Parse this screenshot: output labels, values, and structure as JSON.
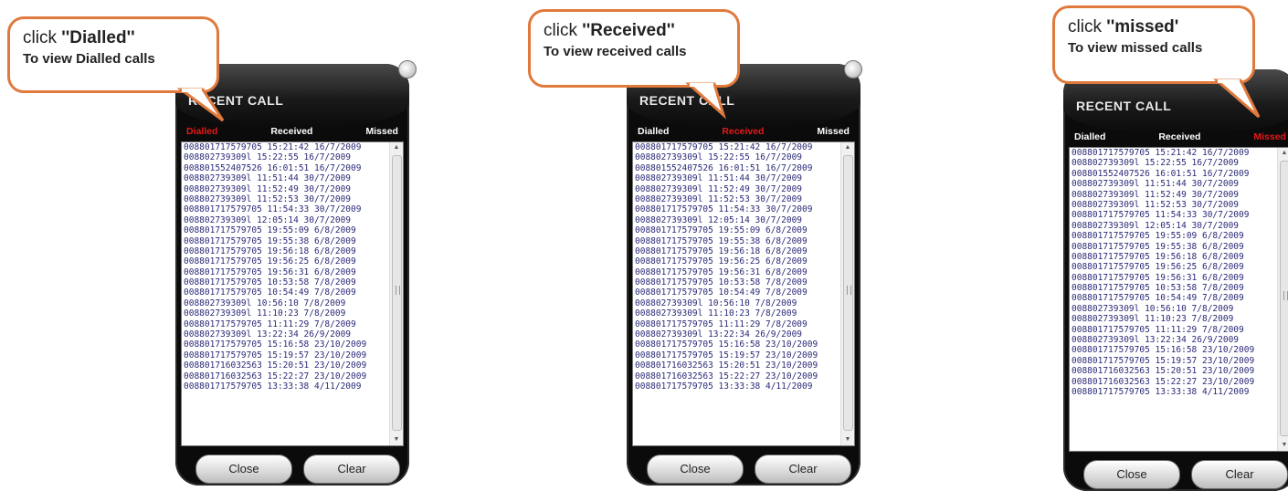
{
  "screen": {
    "title": "RECENT CALL",
    "tabs": [
      "Dialled",
      "Received",
      "Missed"
    ],
    "calls": [
      "008801717579705  15:21:42  16/7/2009",
      "008802739309l  15:22:55  16/7/2009",
      "008801552407526  16:01:51  16/7/2009",
      "008802739309l  11:51:44  30/7/2009",
      "008802739309l  11:52:49  30/7/2009",
      "008802739309l  11:52:53  30/7/2009",
      "008801717579705  11:54:33  30/7/2009",
      "008802739309l  12:05:14  30/7/2009",
      "008801717579705  19:55:09  6/8/2009",
      "008801717579705  19:55:38  6/8/2009",
      "008801717579705  19:56:18  6/8/2009",
      "008801717579705  19:56:25  6/8/2009",
      "008801717579705  19:56:31  6/8/2009",
      "008801717579705  10:53:58  7/8/2009",
      "008801717579705  10:54:49  7/8/2009",
      "008802739309l  10:56:10  7/8/2009",
      "008802739309l  11:10:23  7/8/2009",
      "008801717579705  11:11:29  7/8/2009",
      "008802739309l  13:22:34  26/9/2009",
      "008801717579705  15:16:58  23/10/2009",
      "008801717579705  15:19:57  23/10/2009",
      "008801716032563  15:20:51  23/10/2009",
      "008801716032563  15:22:27  23/10/2009",
      "008801717579705  13:33:38  4/11/2009"
    ],
    "close_label": "Close",
    "clear_label": "Clear"
  },
  "panels": [
    {
      "active_tab": "Dialled",
      "callout": {
        "prefix": "click ",
        "keyword": "''Dialled''",
        "subtitle": "To view Dialled calls"
      }
    },
    {
      "active_tab": "Received",
      "callout": {
        "prefix": "click ",
        "keyword": "''Received''",
        "subtitle": "To view received calls"
      }
    },
    {
      "active_tab": "Missed",
      "callout": {
        "prefix": "click ",
        "keyword": "''missed'",
        "subtitle": "To view missed calls"
      }
    }
  ],
  "colors": {
    "active_tab": "#e21a1a",
    "callout_border": "#e07a3c",
    "call_text": "#2a2a78"
  }
}
